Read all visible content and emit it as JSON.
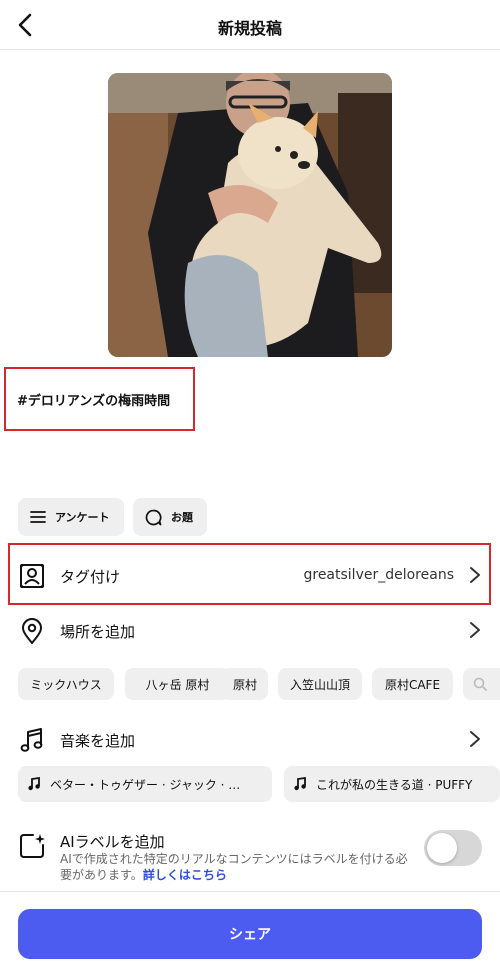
{
  "header": {
    "title": "新規投稿"
  },
  "post": {
    "caption": "#デロリアンズの梅雨時間"
  },
  "chips": {
    "survey": "アンケート",
    "topic": "お題"
  },
  "tag": {
    "label": "タグ付け",
    "value": "greatsilver_deloreans"
  },
  "location": {
    "label": "場所を追加",
    "suggestions": [
      "ミックハウス",
      "八ヶ岳 原村",
      "原村",
      "入笠山山頂",
      "原村CAFE"
    ]
  },
  "music": {
    "label": "音楽を追加",
    "suggestions": [
      "ベター・トゥゲザー · ジャック · …",
      "これが私の生きる道 · PUFFY"
    ]
  },
  "ai_label": {
    "title": "AIラベルを追加",
    "description": "AIで作成された特定のリアルなコンテンツにはラベルを付ける必要があります。",
    "link": "詳しくはこちら",
    "enabled": false
  },
  "share_button": "シェア",
  "colors": {
    "accent": "#4d5cf0",
    "highlight": "#d8252e",
    "link": "#2c4fd8"
  }
}
